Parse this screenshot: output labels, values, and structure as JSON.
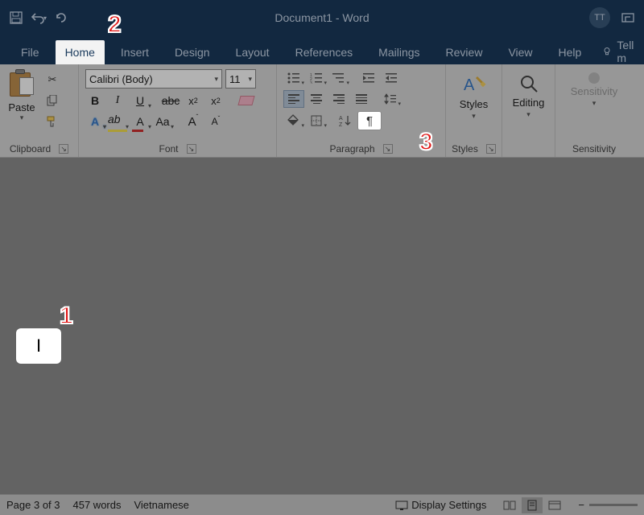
{
  "titlebar": {
    "title": "Document1 - Word",
    "avatar_initials": "TT"
  },
  "tabs": {
    "file": "File",
    "home": "Home",
    "insert": "Insert",
    "design": "Design",
    "layout": "Layout",
    "references": "References",
    "mailings": "Mailings",
    "review": "Review",
    "view": "View",
    "help": "Help",
    "tell_me": "Tell m"
  },
  "ribbon": {
    "clipboard": {
      "paste": "Paste",
      "label": "Clipboard"
    },
    "font": {
      "name": "Calibri (Body)",
      "size": "11",
      "label": "Font",
      "bold": "B",
      "italic": "I",
      "underline": "U",
      "strike": "abc",
      "sub": "x",
      "sup": "x",
      "effects": "A",
      "highlight": "ab",
      "color": "A",
      "case": "Aa",
      "grow": "A",
      "shrink": "A"
    },
    "paragraph": {
      "label": "Paragraph",
      "pilcrow": "¶"
    },
    "styles": {
      "big": "Styles",
      "label": "Styles"
    },
    "editing": {
      "big": "Editing"
    },
    "sensitivity": {
      "big": "Sensitivity",
      "label": "Sensitivity"
    }
  },
  "document": {
    "cursor_char": "I"
  },
  "statusbar": {
    "page": "Page 3 of 3",
    "words": "457 words",
    "language": "Vietnamese",
    "display": "Display Settings"
  },
  "annotations": {
    "one": "1",
    "two": "2",
    "three": "3"
  }
}
